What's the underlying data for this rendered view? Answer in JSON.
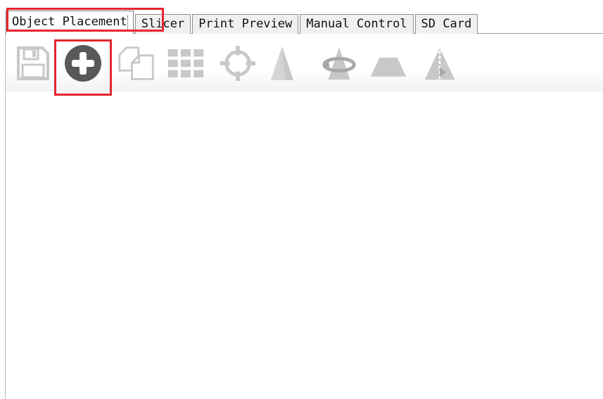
{
  "tabs": [
    {
      "label": "Object Placement",
      "active": true
    },
    {
      "label": "Slicer",
      "active": false
    },
    {
      "label": "Print Preview",
      "active": false
    },
    {
      "label": "Manual Control",
      "active": false
    },
    {
      "label": "SD Card",
      "active": false
    }
  ],
  "toolbar": {
    "icons": [
      {
        "name": "save-icon",
        "enabled": false
      },
      {
        "name": "add-object-icon",
        "enabled": true
      },
      {
        "name": "copy-icon",
        "enabled": false
      },
      {
        "name": "arrange-grid-icon",
        "enabled": false
      },
      {
        "name": "center-icon",
        "enabled": false
      },
      {
        "name": "scale-icon",
        "enabled": false
      },
      {
        "name": "rotate-icon",
        "enabled": false
      },
      {
        "name": "cut-icon",
        "enabled": false
      },
      {
        "name": "mirror-icon",
        "enabled": false
      }
    ]
  },
  "highlight": {
    "color": "#e5262f"
  },
  "colors": {
    "disabled_icon": "#c8c8c8",
    "enabled_icon": "#595959"
  }
}
